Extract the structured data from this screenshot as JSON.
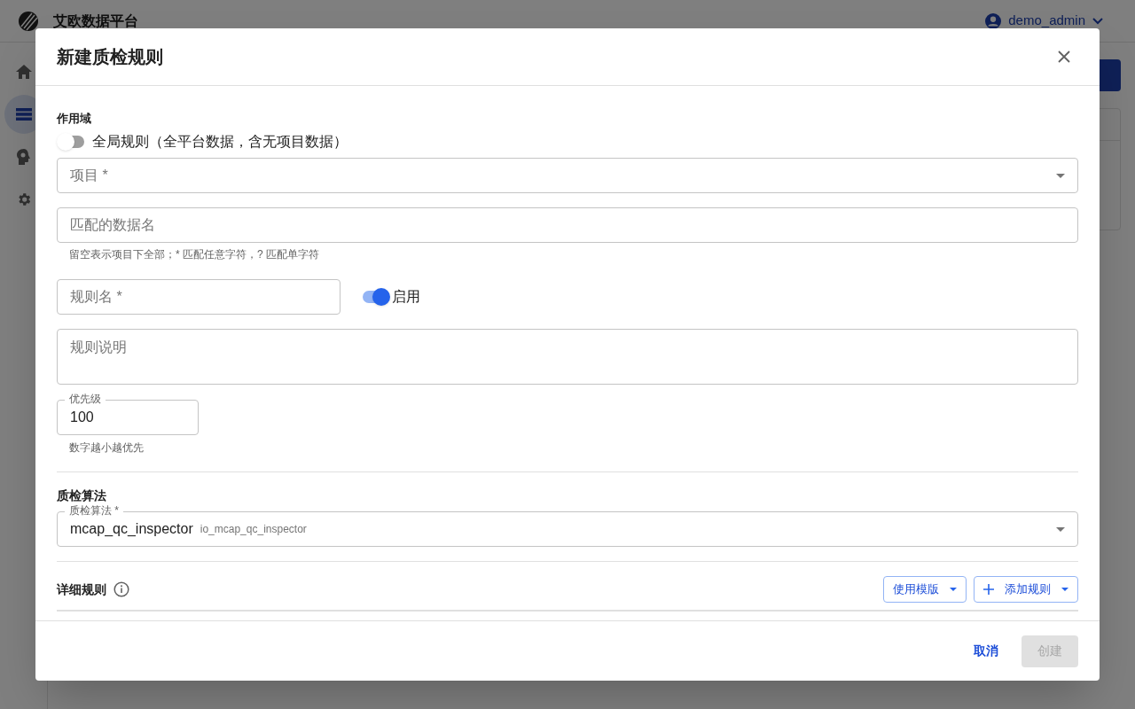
{
  "app_bar": {
    "title": "艾欧数据平台",
    "user": "demo_admin"
  },
  "sidebar": {
    "items": [
      {
        "kind": "home",
        "selected": false
      },
      {
        "kind": "list",
        "selected": true
      },
      {
        "kind": "brain",
        "selected": false
      },
      {
        "kind": "settings",
        "selected": false
      }
    ]
  },
  "dialog": {
    "title": "新建质检规则",
    "scope": {
      "heading": "作用域",
      "global_switch": {
        "label": "全局规则（全平台数据，含无项目数据）",
        "on": false
      }
    },
    "project_field": {
      "placeholder": "项目 *"
    },
    "dataset_field": {
      "placeholder": "匹配的数据名",
      "helper": "留空表示项目下全部；* 匹配任意字符，? 匹配单字符"
    },
    "rule_name_field": {
      "placeholder": "规则名 *"
    },
    "enabled_switch": {
      "label": "启用",
      "on": true
    },
    "description_field": {
      "placeholder": "规则说明"
    },
    "priority_field": {
      "label": "优先级",
      "value": "100",
      "helper": "数字越小越优先"
    },
    "algorithm": {
      "heading": "质检算法",
      "label": "质检算法 *",
      "value": "mcap_qc_inspector",
      "secondary": "io_mcap_qc_inspector"
    },
    "details": {
      "heading": "详细规则",
      "buttons": [
        {
          "kind": "template",
          "label": "使用模版"
        },
        {
          "kind": "add",
          "label": "添加规则"
        }
      ]
    },
    "footer": {
      "cancel": "取消",
      "create": {
        "label": "创建",
        "disabled": true
      }
    }
  }
}
